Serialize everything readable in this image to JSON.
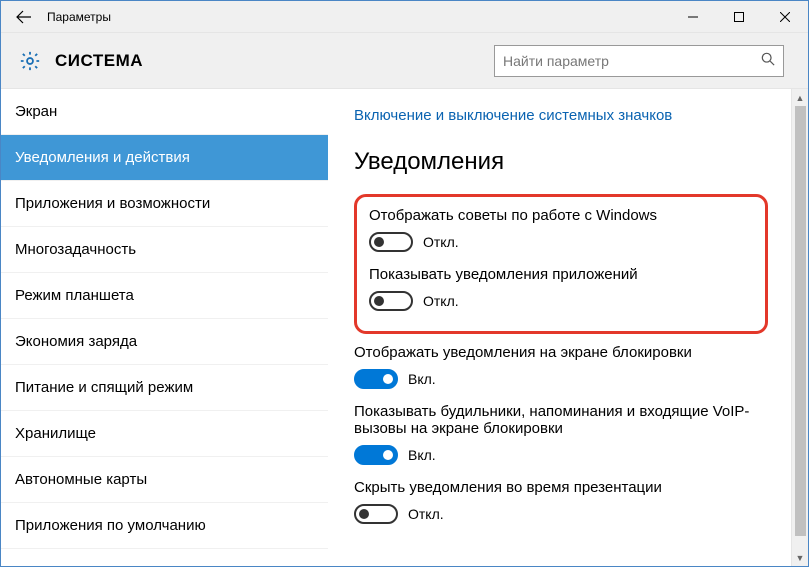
{
  "window": {
    "title": "Параметры"
  },
  "header": {
    "category": "СИСТЕМА",
    "search_placeholder": "Найти параметр"
  },
  "sidebar": {
    "items": [
      {
        "label": "Экран",
        "selected": false
      },
      {
        "label": "Уведомления и действия",
        "selected": true
      },
      {
        "label": "Приложения и возможности",
        "selected": false
      },
      {
        "label": "Многозадачность",
        "selected": false
      },
      {
        "label": "Режим планшета",
        "selected": false
      },
      {
        "label": "Экономия заряда",
        "selected": false
      },
      {
        "label": "Питание и спящий режим",
        "selected": false
      },
      {
        "label": "Хранилище",
        "selected": false
      },
      {
        "label": "Автономные карты",
        "selected": false
      },
      {
        "label": "Приложения по умолчанию",
        "selected": false
      }
    ]
  },
  "content": {
    "link": "Включение и выключение системных значков",
    "section_title": "Уведомления",
    "state_on": "Вкл.",
    "state_off": "Откл.",
    "settings": [
      {
        "label": "Отображать советы по работе с Windows",
        "on": false,
        "highlighted": true
      },
      {
        "label": "Показывать уведомления приложений",
        "on": false,
        "highlighted": true
      },
      {
        "label": "Отображать уведомления на экране блокировки",
        "on": true,
        "highlighted": false
      },
      {
        "label": "Показывать будильники, напоминания и входящие VoIP-вызовы на экране блокировки",
        "on": true,
        "highlighted": false
      },
      {
        "label": "Скрыть уведомления во время презентации",
        "on": false,
        "highlighted": false
      }
    ]
  }
}
